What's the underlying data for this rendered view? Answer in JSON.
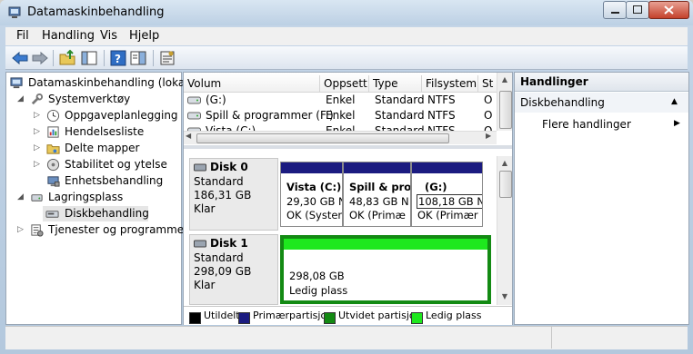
{
  "window": {
    "title": "Datamaskinbehandling"
  },
  "menu": [
    {
      "label": "Fil"
    },
    {
      "label": "Handling"
    },
    {
      "label": "Vis"
    },
    {
      "label": "Hjelp"
    }
  ],
  "toolbar": {
    "icons": [
      "back-icon",
      "forward-icon",
      "up-folder-icon",
      "show-tree-icon",
      "help-icon",
      "properties-icon",
      "settings-icon"
    ]
  },
  "tree": {
    "root": "Datamaskinbehandling (lokal)",
    "items": [
      {
        "label": "Systemverktøy"
      },
      {
        "label": "Oppgaveplanlegging"
      },
      {
        "label": "Hendelsesliste"
      },
      {
        "label": "Delte mapper"
      },
      {
        "label": "Stabilitet og ytelse"
      },
      {
        "label": "Enhetsbehandling"
      },
      {
        "label": "Lagringsplass"
      },
      {
        "label": "Diskbehandling"
      },
      {
        "label": "Tjenester og programmer"
      }
    ]
  },
  "volumes": {
    "columns": [
      "Volum",
      "Oppsett",
      "Type",
      "Filsystem",
      "St"
    ],
    "rows": [
      {
        "volume": "(G:)",
        "layout": "Enkel",
        "type": "Standard",
        "fs": "NTFS",
        "status": "O"
      },
      {
        "volume": "Spill & programmer (F:)",
        "layout": "Enkel",
        "type": "Standard",
        "fs": "NTFS",
        "status": "O"
      },
      {
        "volume": "Vista (C:)",
        "layout": "Enkel",
        "type": "Standard",
        "fs": "NTFS",
        "status": "O"
      }
    ]
  },
  "disks": [
    {
      "name": "Disk 0",
      "type": "Standard",
      "size": "186,31 GB",
      "state": "Klar",
      "partitions": [
        {
          "name": "Vista  (C:)",
          "size": "29,30 GB N",
          "status": "OK (Syster"
        },
        {
          "name": "Spill & pro",
          "size": "48,83 GB N",
          "status": "OK (Primæ"
        },
        {
          "name": "(G:)",
          "size": "108,18 GB NTFS",
          "status": "OK (Primær"
        }
      ]
    },
    {
      "name": "Disk 1",
      "type": "Standard",
      "size": "298,09 GB",
      "state": "Klar",
      "partitions": [
        {
          "size": "298,08 GB",
          "status": "Ledig plass"
        }
      ]
    }
  ],
  "legend": [
    {
      "label": "Utildelt",
      "color": "#000000"
    },
    {
      "label": "Primærpartisjon",
      "color": "#1b1b80"
    },
    {
      "label": "Utvidet partisjon",
      "color": "#138a13"
    },
    {
      "label": "Ledig plass",
      "color": "#1ee81e"
    }
  ],
  "actions": {
    "header": "Handlinger",
    "section": "Diskbehandling",
    "more": "Flere handlinger"
  }
}
